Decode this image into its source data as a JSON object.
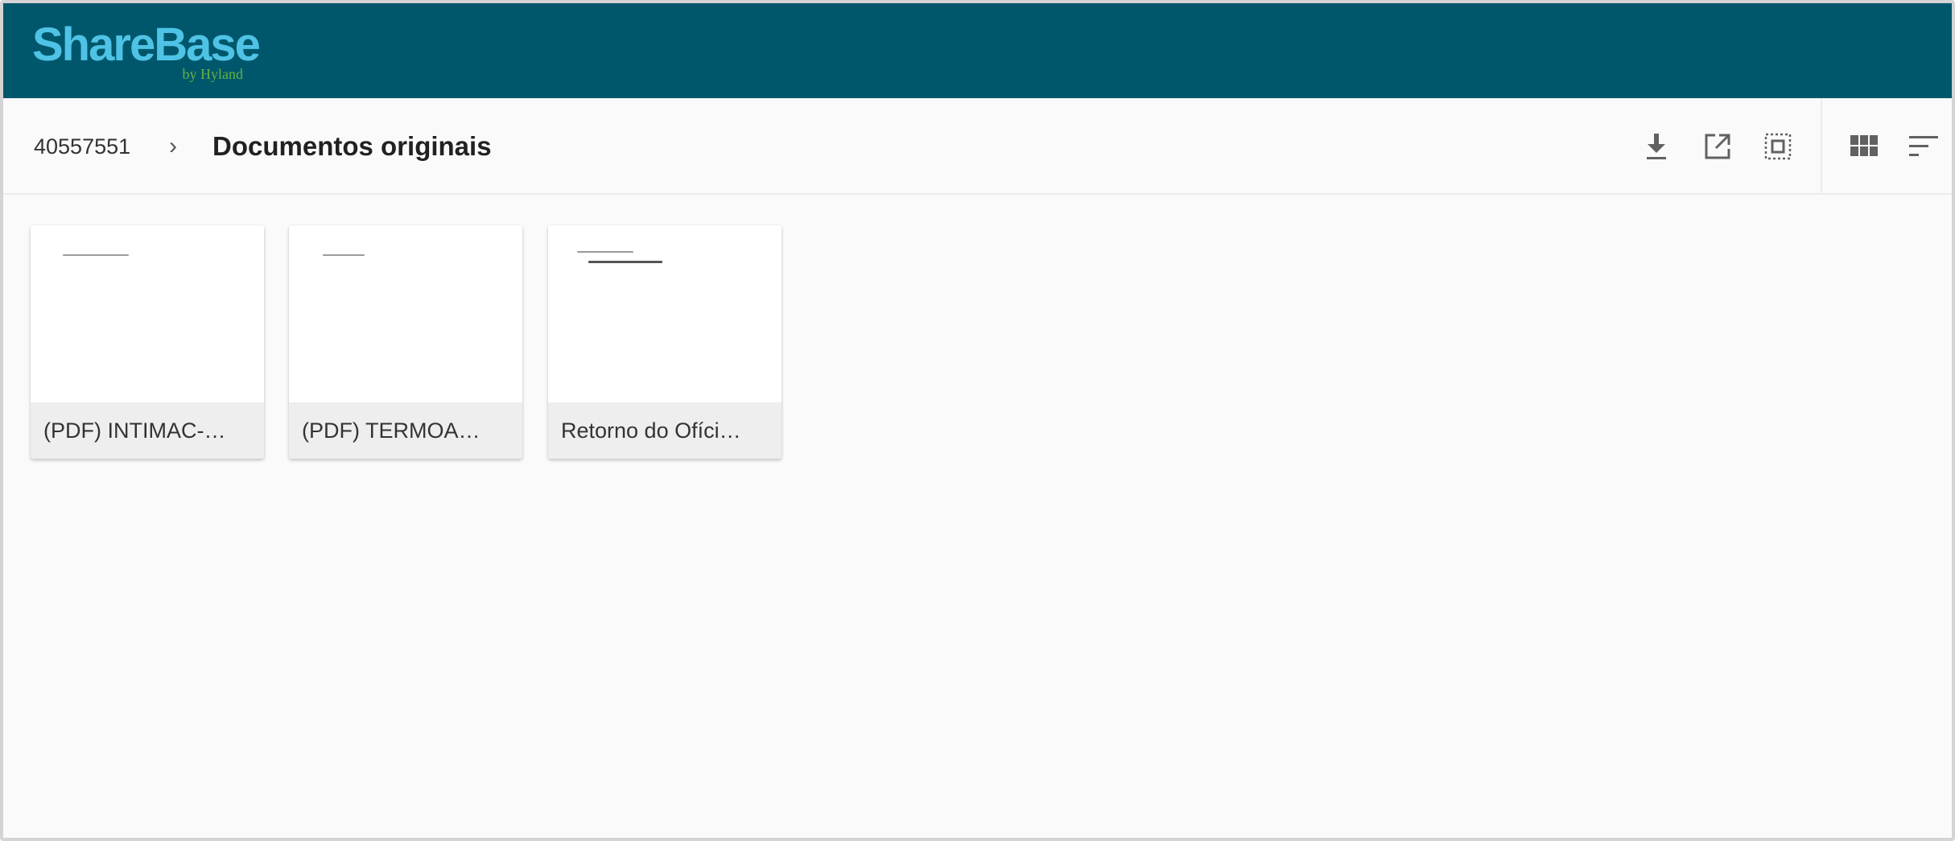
{
  "header": {
    "logo_text": "ShareBase",
    "logo_subtext": "by Hyland"
  },
  "breadcrumb": {
    "root": "40557551",
    "separator": "›",
    "current": "Documentos originais"
  },
  "toolbar": {
    "actions": [
      {
        "name": "download",
        "icon": "download-icon"
      },
      {
        "name": "open-external",
        "icon": "open-external-icon"
      },
      {
        "name": "select-all",
        "icon": "select-all-icon"
      },
      {
        "name": "grid-view",
        "icon": "grid-view-icon"
      },
      {
        "name": "sort",
        "icon": "sort-icon"
      }
    ]
  },
  "files": [
    {
      "label": "(PDF) INTIMAC-…"
    },
    {
      "label": "(PDF) TERMOA…"
    },
    {
      "label": "Retorno do Ofíci…"
    }
  ],
  "colors": {
    "header_bg": "#00576b",
    "logo": "#4fc3e6",
    "logo_sub": "#63b246",
    "icon": "#616161"
  }
}
